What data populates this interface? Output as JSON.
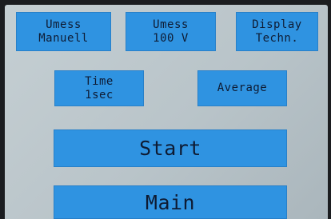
{
  "buttons": {
    "umess_manuell": {
      "line1": "Umess",
      "line2": "Manuell"
    },
    "umess_100v": {
      "line1": "Umess",
      "line2": "100 V"
    },
    "display_techn": {
      "line1": "Display",
      "line2": "Techn."
    },
    "time_1sec": {
      "line1": "Time",
      "line2": "1sec"
    },
    "average": {
      "label": "Average"
    },
    "start": {
      "label": "Start"
    },
    "main": {
      "label": "Main"
    }
  },
  "colors": {
    "button_fill": "#2f93e1",
    "button_text": "#0e1b33",
    "screen_background": "#bfc9ce",
    "bezel": "#1b1d20"
  }
}
